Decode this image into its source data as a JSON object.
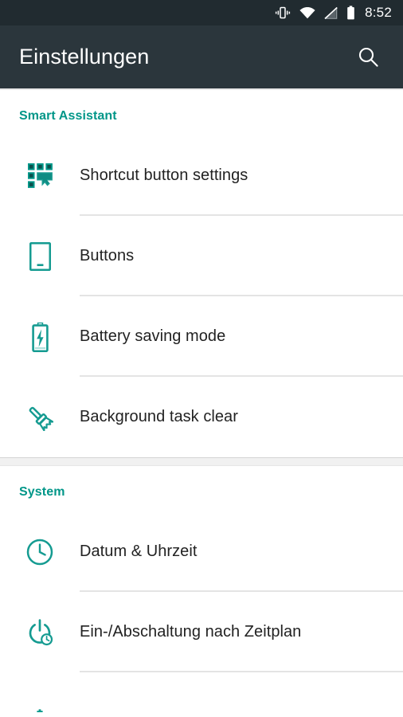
{
  "status_bar": {
    "icons": [
      "vibrate-icon",
      "wifi-icon",
      "no-sim-signal-icon",
      "battery-icon"
    ],
    "time": "8:52"
  },
  "app_bar": {
    "title": "Einstellungen",
    "search_icon": "search-icon"
  },
  "theme": {
    "accent": "#009688",
    "app_bar_bg": "#2b363c",
    "status_bar_bg": "#212b30",
    "label_color": "#222222",
    "divider": "#e4e4e4"
  },
  "sections": [
    {
      "title": "Smart Assistant",
      "items": [
        {
          "label": "Shortcut button settings",
          "icon": "grid-shortcut-icon"
        },
        {
          "label": "Buttons",
          "icon": "phone-device-icon"
        },
        {
          "label": "Battery saving mode",
          "icon": "battery-bolt-icon"
        },
        {
          "label": "Background task clear",
          "icon": "broom-icon"
        }
      ]
    },
    {
      "title": "System",
      "items": [
        {
          "label": "Datum & Uhrzeit",
          "icon": "clock-icon"
        },
        {
          "label": "Ein-/Abschaltung nach Zeitplan",
          "icon": "power-schedule-icon"
        },
        {
          "label": "",
          "icon": "partial-cut-off-icon"
        }
      ]
    }
  ]
}
